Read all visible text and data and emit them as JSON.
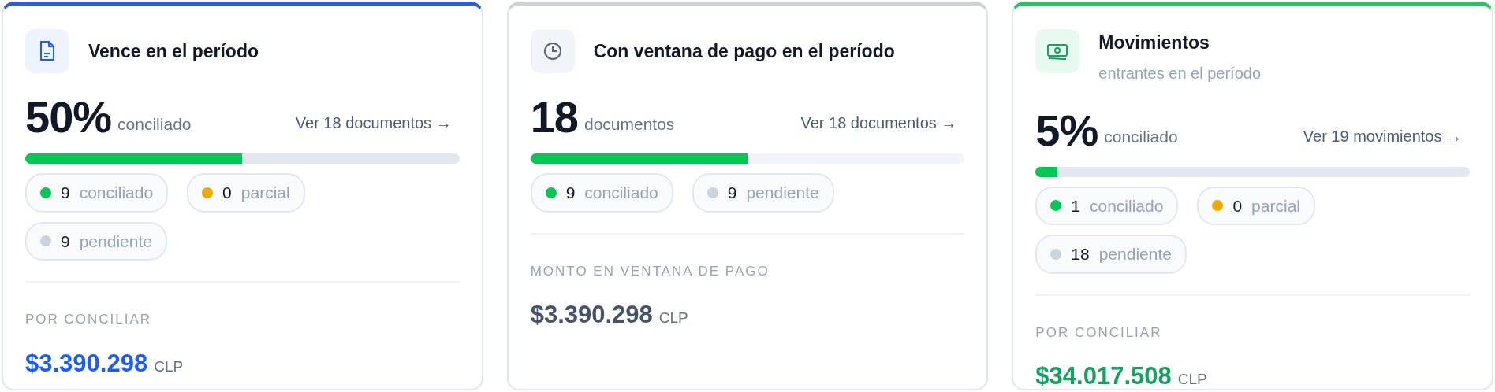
{
  "cards": [
    {
      "kind": "document",
      "color": "#2f5bdc",
      "title": "Vence en el período",
      "headline": {
        "value": "50%",
        "unit": "conciliado"
      },
      "link": "Ver 18 documentos →",
      "progress": {
        "level": 0.5
      },
      "chips": [
        {
          "count": "9",
          "label": "conciliado",
          "color": "#00c853"
        },
        {
          "count": "0",
          "label": "parcial",
          "color": "#eeaa00"
        },
        {
          "count": "9",
          "label": "pendiente",
          "color": "#cbd3de"
        }
      ],
      "footer": {
        "label": "POR CONCILIAR",
        "amount": "$3.390.298",
        "currency": "CLP",
        "color": "#1a5cff"
      }
    },
    {
      "kind": "clock",
      "color": "#cbd2dc",
      "title": "Con ventana de pago en el período",
      "headline": {
        "value": "18",
        "unit": "documentos"
      },
      "link": "Ver 18 documentos →",
      "progress": {
        "level": 0.5
      },
      "chips": [
        {
          "count": "9",
          "label": "conciliado",
          "color": "#00c853"
        },
        {
          "count": "9",
          "label": "pendiente",
          "color": "#cbd3de"
        }
      ],
      "footer": {
        "label": "MONTO EN VENTANA DE PAGO",
        "amount": "$3.390.298",
        "currency": "CLP",
        "color": "#45546d"
      }
    },
    {
      "kind": "cash",
      "color": "#22c55e",
      "title": "Movimientos",
      "subtitle": "entrantes en el período",
      "headline": {
        "value": "5%",
        "unit": "conciliado"
      },
      "link": "Ver 19 movimientos →",
      "progress": {
        "level": 0.05
      },
      "chips": [
        {
          "count": "1",
          "label": "conciliado",
          "color": "#00c853"
        },
        {
          "count": "0",
          "label": "parcial",
          "color": "#eeaa00"
        },
        {
          "count": "18",
          "label": "pendiente",
          "color": "#cbd3de"
        }
      ],
      "footer": {
        "label": "POR CONCILIAR",
        "amount": "$34.017.508",
        "currency": "CLP",
        "color": "#14a35f"
      }
    }
  ]
}
